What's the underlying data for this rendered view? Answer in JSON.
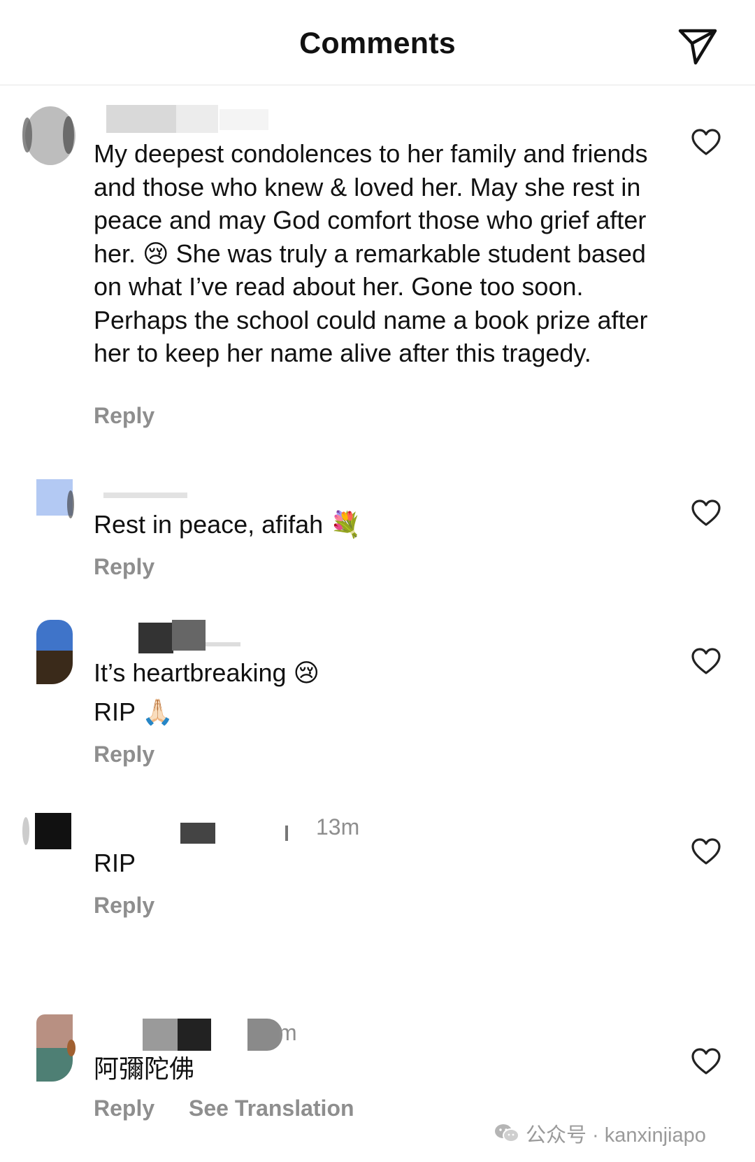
{
  "header": {
    "title": "Comments",
    "share_icon": "send-icon"
  },
  "comments": [
    {
      "text": "My deepest condolences to her family and friends and those who knew & loved her. May she rest in peace and may God comfort those who grief after her. 😢 She was truly a remarkable student based on what I’ve read about her. Gone too soon. Perhaps the school could name a book prize after her to keep her name alive after this tragedy.",
      "reply_label": "Reply",
      "like_icon": "heart-outline-icon"
    },
    {
      "text": "Rest in peace, afifah 💐",
      "reply_label": "Reply",
      "like_icon": "heart-outline-icon"
    },
    {
      "text_line1": "It’s heartbreaking 😢",
      "text_line2": "RIP 🙏🏻",
      "reply_label": "Reply",
      "like_icon": "heart-outline-icon"
    },
    {
      "time": "13m",
      "text": "RIP",
      "reply_label": "Reply",
      "like_icon": "heart-outline-icon"
    },
    {
      "time": "m",
      "text": "阿彌陀佛",
      "reply_label": "Reply",
      "see_translation_label": "See Translation",
      "like_icon": "heart-outline-icon"
    }
  ],
  "watermark": {
    "text": "公众号 · kanxinjiapo",
    "icon": "wechat-icon"
  }
}
